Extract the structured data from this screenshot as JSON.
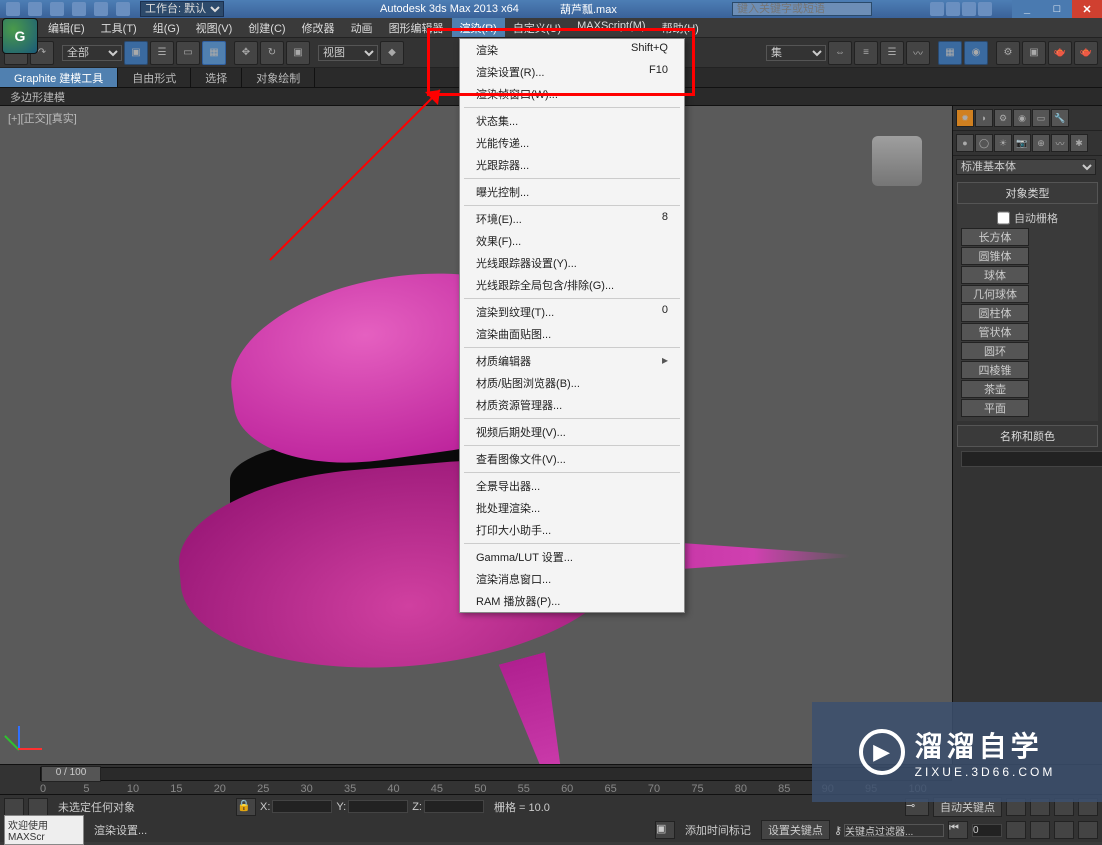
{
  "titlebar": {
    "workspace_label": "工作台: 默认",
    "app_title": "Autodesk 3ds Max  2013 x64",
    "file_name": "葫芦瓢.max",
    "search_placeholder": "键入关键字或短语"
  },
  "menubar": {
    "items": [
      "编辑(E)",
      "工具(T)",
      "组(G)",
      "视图(V)",
      "创建(C)",
      "修改器",
      "动画",
      "图形编辑器",
      "渲染(R)",
      "自定义(U)",
      "MAXScript(M)",
      "帮助(H)"
    ]
  },
  "toolbar": {
    "filter_dropdown": "全部",
    "view_dropdown": "视图",
    "set_dropdown": "集"
  },
  "ribbon": {
    "tabs": [
      "Graphite 建模工具",
      "自由形式",
      "选择",
      "对象绘制"
    ],
    "sub": "多边形建模"
  },
  "viewport": {
    "label": "[+][正交][真实]"
  },
  "dropdown": {
    "items": [
      {
        "label": "渲染",
        "shortcut": "Shift+Q"
      },
      {
        "label": "渲染设置(R)...",
        "shortcut": "F10"
      },
      {
        "label": "渲染帧窗口(W)..."
      },
      {
        "sep": true
      },
      {
        "label": "状态集..."
      },
      {
        "label": "光能传递..."
      },
      {
        "label": "光跟踪器..."
      },
      {
        "sep": true
      },
      {
        "label": "曝光控制..."
      },
      {
        "sep": true
      },
      {
        "label": "环境(E)...",
        "shortcut": "8"
      },
      {
        "label": "效果(F)..."
      },
      {
        "label": "光线跟踪器设置(Y)..."
      },
      {
        "label": "光线跟踪全局包含/排除(G)..."
      },
      {
        "sep": true
      },
      {
        "label": "渲染到纹理(T)...",
        "shortcut": "0"
      },
      {
        "label": "渲染曲面贴图..."
      },
      {
        "sep": true
      },
      {
        "label": "材质编辑器",
        "submenu": true
      },
      {
        "label": "材质/贴图浏览器(B)..."
      },
      {
        "label": "材质资源管理器..."
      },
      {
        "sep": true
      },
      {
        "label": "视频后期处理(V)..."
      },
      {
        "sep": true
      },
      {
        "label": "查看图像文件(V)..."
      },
      {
        "sep": true
      },
      {
        "label": "全景导出器..."
      },
      {
        "label": "批处理渲染..."
      },
      {
        "label": "打印大小助手..."
      },
      {
        "sep": true
      },
      {
        "label": "Gamma/LUT 设置..."
      },
      {
        "label": "渲染消息窗口..."
      },
      {
        "label": "RAM 播放器(P)..."
      }
    ]
  },
  "right_panel": {
    "dropdown": "标准基本体",
    "rollout1_title": "对象类型",
    "auto_grid": "自动栅格",
    "objects": [
      "长方体",
      "圆锥体",
      "球体",
      "几何球体",
      "圆柱体",
      "管状体",
      "圆环",
      "四棱锥",
      "茶壶",
      "平面"
    ],
    "rollout2_title": "名称和颜色"
  },
  "timeline": {
    "slider": "0 / 100",
    "ticks": [
      "0",
      "5",
      "10",
      "15",
      "20",
      "25",
      "30",
      "35",
      "40",
      "45",
      "50",
      "55",
      "60",
      "65",
      "70",
      "75",
      "80",
      "85",
      "90",
      "95",
      "100"
    ]
  },
  "status": {
    "selection": "未选定任何对象",
    "welcome": "欢迎使用  MAXScr",
    "render_setup": "渲染设置...",
    "grid": "栅格 = 10.0",
    "auto_key": "自动关键点",
    "set_key": "设置关键点",
    "add_time_tag": "添加时间标记",
    "key_filter": "关键点过滤器...",
    "frame_value": "0"
  },
  "logo": {
    "main": "溜溜自学",
    "sub": "ZIXUE.3D66.COM"
  }
}
